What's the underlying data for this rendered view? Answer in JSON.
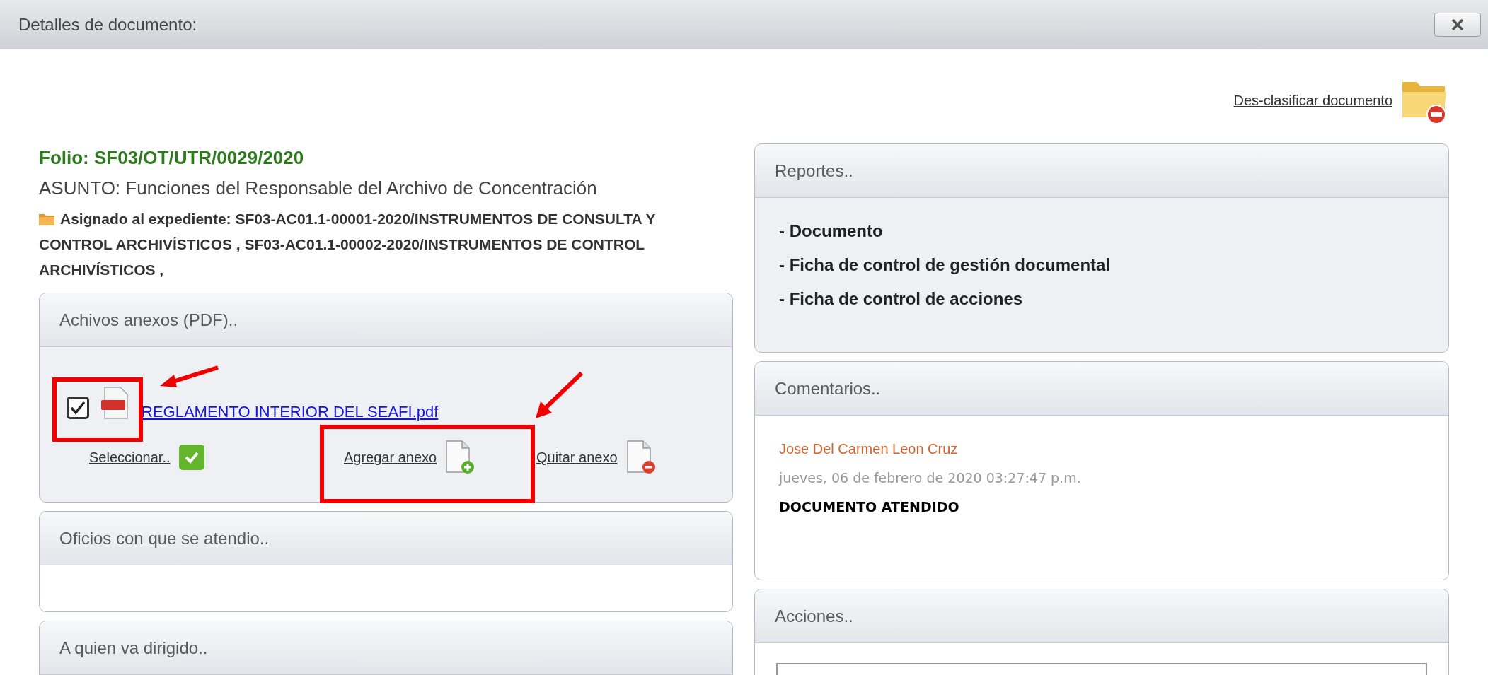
{
  "window": {
    "title": "Detalles de documento:"
  },
  "declassify_link": "Des-clasificar documento",
  "folio": "Folio: SF03/OT/UTR/0029/2020",
  "asunto": "ASUNTO: Funciones del Responsable del Archivo de Concentración",
  "assignment": "Asignado al expediente: SF03-AC01.1-00001-2020/INSTRUMENTOS DE CONSULTA Y CONTROL ARCHIVÍSTICOS , SF03-AC01.1-00002-2020/INSTRUMENTOS DE CONTROL ARCHIVÍSTICOS ,",
  "attachments_panel": {
    "title": "Achivos anexos (PDF)..",
    "files": [
      {
        "name": "REGLAMENTO INTERIOR DEL SEAFI.pdf",
        "checked": true
      }
    ],
    "actions": [
      {
        "kind": "select",
        "label": "Seleccionar.."
      },
      {
        "kind": "add",
        "label": "Agregar anexo"
      },
      {
        "kind": "remove",
        "label": "Quitar anexo"
      }
    ]
  },
  "oficios_panel": {
    "title": "Oficios con que se atendio.."
  },
  "recipient_panel": {
    "title": "A quien va dirigido.."
  },
  "reports_panel": {
    "title": "Reportes..",
    "items": [
      "- Documento",
      "- Ficha de control de gestión documental",
      "- Ficha de control de acciones"
    ]
  },
  "comments_panel": {
    "title": "Comentarios..",
    "comments": [
      {
        "author": "Jose Del Carmen Leon Cruz",
        "date": "jueves, 06 de febrero de 2020 03:27:47 p.m.",
        "text": "DOCUMENTO ATENDIDO"
      }
    ]
  },
  "actions_panel": {
    "title": "Acciones.."
  }
}
